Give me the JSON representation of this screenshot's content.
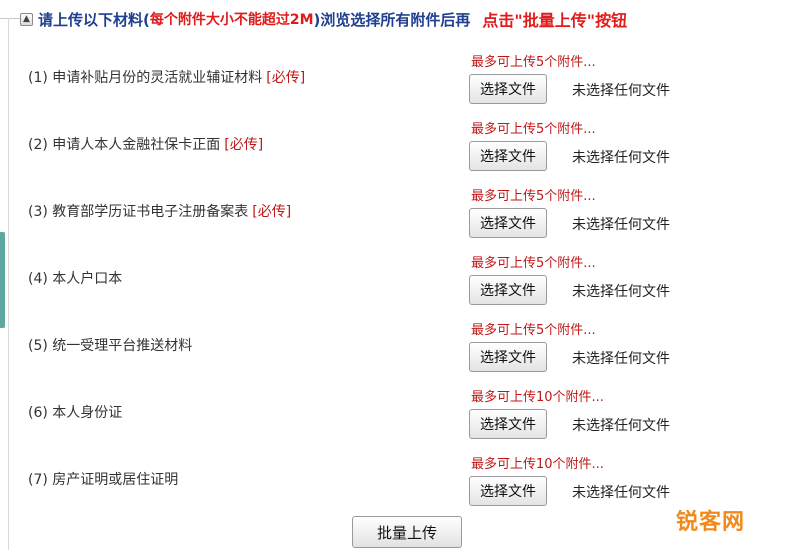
{
  "header": {
    "text_blue_1": "请上传以下材料(",
    "text_red": "每个附件大小不能超过2M",
    "text_blue_2": ")浏览选择所有附件后再",
    "text_red_big": "点击\"批量上传\"按钮"
  },
  "rows": [
    {
      "label": "(1) 申请补贴月份的灵活就业辅证材料",
      "required": "[必传]",
      "hint": "最多可上传5个附件...",
      "button": "选择文件",
      "status": "未选择任何文件"
    },
    {
      "label": "(2) 申请人本人金融社保卡正面",
      "required": "[必传]",
      "hint": "最多可上传5个附件...",
      "button": "选择文件",
      "status": "未选择任何文件"
    },
    {
      "label": "(3) 教育部学历证书电子注册备案表",
      "required": "[必传]",
      "hint": "最多可上传5个附件...",
      "button": "选择文件",
      "status": "未选择任何文件"
    },
    {
      "label": "(4) 本人户口本",
      "required": "",
      "hint": "最多可上传5个附件...",
      "button": "选择文件",
      "status": "未选择任何文件"
    },
    {
      "label": "(5) 统一受理平台推送材料",
      "required": "",
      "hint": "最多可上传5个附件...",
      "button": "选择文件",
      "status": "未选择任何文件"
    },
    {
      "label": "(6) 本人身份证",
      "required": "",
      "hint": "最多可上传10个附件...",
      "button": "选择文件",
      "status": "未选择任何文件"
    },
    {
      "label": "(7) 房产证明或居住证明",
      "required": "",
      "hint": "最多可上传10个附件...",
      "button": "选择文件",
      "status": "未选择任何文件"
    }
  ],
  "batch_upload_label": "批量上传",
  "watermark": "锐客网",
  "colors": {
    "accent_blue": "#1f3f8f",
    "required_red": "#c01818",
    "warning_red": "#e01b1b",
    "watermark_orange": "#f08a1c"
  }
}
